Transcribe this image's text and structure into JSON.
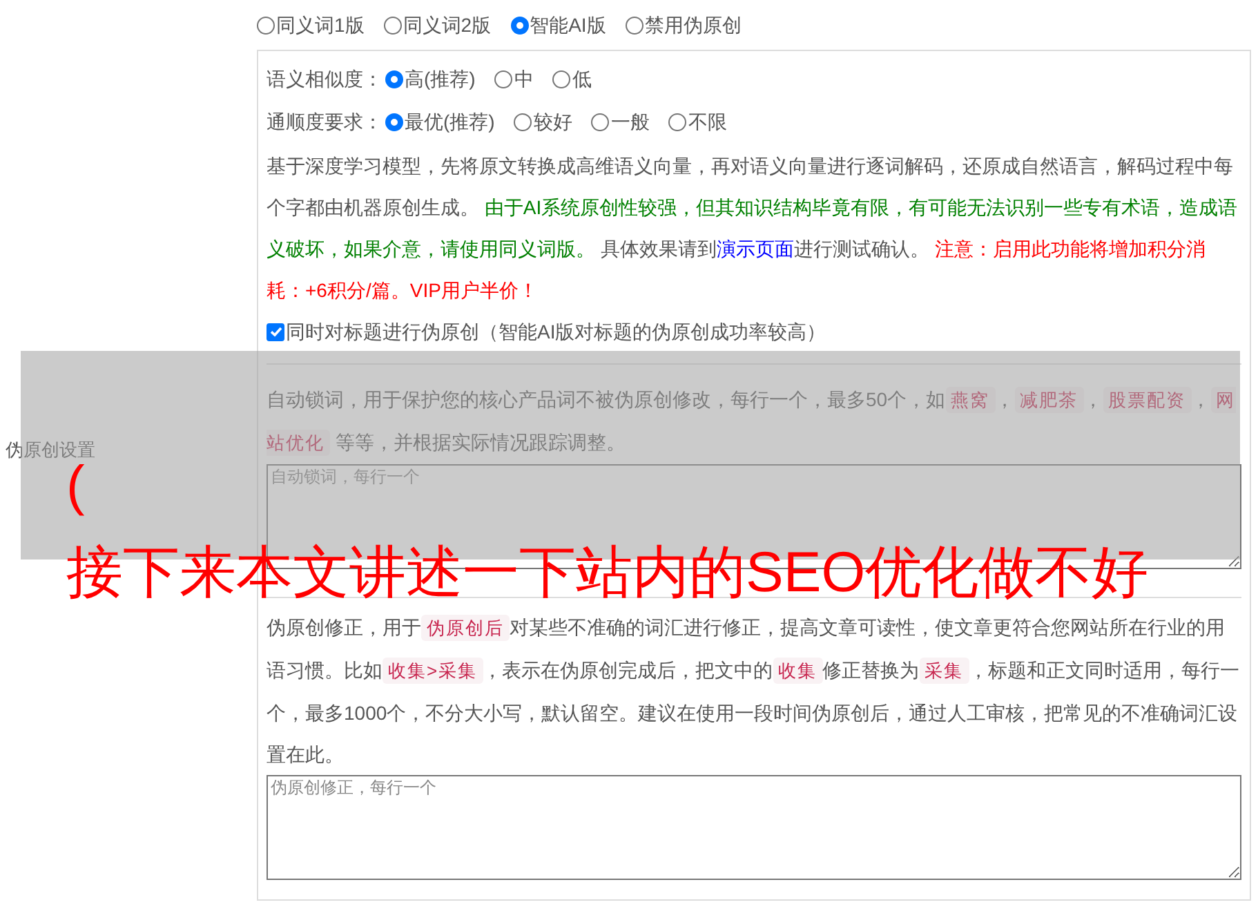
{
  "section_label": "伪原创设置",
  "modes": [
    {
      "label": "同义词1版",
      "selected": false
    },
    {
      "label": "同义词2版",
      "selected": false
    },
    {
      "label": "智能AI版",
      "selected": true
    },
    {
      "label": "禁用伪原创",
      "selected": false
    }
  ],
  "similarity": {
    "label": "语义相似度：",
    "options": [
      {
        "label": "高(推荐)",
        "selected": true
      },
      {
        "label": "中",
        "selected": false
      },
      {
        "label": "低",
        "selected": false
      }
    ]
  },
  "fluency": {
    "label": "通顺度要求：",
    "options": [
      {
        "label": "最优(推荐)",
        "selected": true
      },
      {
        "label": "较好",
        "selected": false
      },
      {
        "label": "一般",
        "selected": false
      },
      {
        "label": "不限",
        "selected": false
      }
    ]
  },
  "ai_description": [
    {
      "kind": "text",
      "text": "基于深度学习模型，先将原文转换成高维语义向量，再对语义向量进行逐词解码，还原成自然语言，解码过程中每个字都由机器原创生成。 "
    },
    {
      "kind": "note",
      "text": "由于AI系统原创性较强，但其知识结构毕竟有限，有可能无法识别一些专有术语，造成语义破坏，如果介意，请使用同义词版。"
    },
    {
      "kind": "text",
      "text": " 具体效果请到"
    },
    {
      "kind": "link",
      "text": "演示页面"
    },
    {
      "kind": "text",
      "text": "进行测试确认。 "
    },
    {
      "kind": "warning",
      "text": "注意：启用此功能将增加积分消耗：+6积分/篇。VIP用户半价！"
    }
  ],
  "title_option": {
    "label": "同时对标题进行伪原创（智能AI版对标题的伪原创成功率较高）",
    "checked": true
  },
  "lock_words": {
    "description": [
      {
        "kind": "text",
        "text": "自动锁词，用于保护您的核心产品词不被伪原创修改，每行一个，最多50个，如"
      },
      {
        "kind": "code",
        "text": "燕窝"
      },
      {
        "kind": "text",
        "text": "，"
      },
      {
        "kind": "code",
        "text": "减肥茶"
      },
      {
        "kind": "text",
        "text": "，"
      },
      {
        "kind": "code",
        "text": "股票配资"
      },
      {
        "kind": "text",
        "text": "，"
      },
      {
        "kind": "code",
        "text": "网站优化"
      },
      {
        "kind": "text",
        "text": " 等等，并根据实际情况跟踪调整。"
      }
    ],
    "placeholder": "自动锁词，每行一个"
  },
  "corrections": {
    "description": [
      {
        "kind": "text",
        "text": "伪原创修正，用于"
      },
      {
        "kind": "code",
        "text": "伪原创后"
      },
      {
        "kind": "text",
        "text": "对某些不准确的词汇进行修正，提高文章可读性，使文章更符合您网站所在行业的用语习惯。比如"
      },
      {
        "kind": "code",
        "text": "收集>采集"
      },
      {
        "kind": "text",
        "text": "，表示在伪原创完成后，把文中的"
      },
      {
        "kind": "code",
        "text": "收集"
      },
      {
        "kind": "text",
        "text": "修正替换为"
      },
      {
        "kind": "code",
        "text": "采集"
      },
      {
        "kind": "text",
        "text": "，标题和正文同时适用，每行一个，最多1000个，不分大小写，默认留空。建议在使用一段时间伪原创后，通过人工审核，把常见的不准确词汇设置在此。"
      }
    ],
    "placeholder": "伪原创修正，每行一个"
  },
  "overlay": {
    "mark": "(",
    "caption": "接下来本文讲述一下站内的SEO优化做不好"
  }
}
